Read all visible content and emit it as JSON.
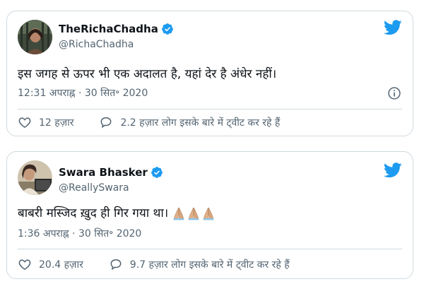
{
  "colors": {
    "twitter_blue": "#1d9bf0",
    "secondary_text": "#536471",
    "border": "#cfd9de"
  },
  "tweets": [
    {
      "display_name": "TheRichaChadha",
      "handle": "@RichaChadha",
      "text": "इस जगह से ऊपर भी एक अदालत है, यहां देर है अंधेर नहीं।",
      "emojis": [],
      "time": "12:31 अपराह्न · 30 सित॰ 2020",
      "likes": "12 हज़ार",
      "replies": "2.2 हज़ार लोग इसके बारे में ट्वीट कर रहे हैं",
      "icons": [
        "verified-icon",
        "twitter-bird-icon",
        "info-icon",
        "heart-icon",
        "comment-icon"
      ]
    },
    {
      "display_name": "Swara Bhasker",
      "handle": "@ReallySwara",
      "text": "बाबरी मस्जिद ख़ुद ही गिर गया था।",
      "emojis": [
        "folded-hands",
        "folded-hands",
        "folded-hands"
      ],
      "time": "1:36 अपराह्न · 30 सित॰ 2020",
      "likes": "20.4 हज़ार",
      "replies": "9.7 हज़ार लोग इसके बारे में ट्वीट कर रहे हैं",
      "icons": [
        "verified-icon",
        "twitter-bird-icon",
        "heart-icon",
        "comment-icon"
      ]
    }
  ]
}
